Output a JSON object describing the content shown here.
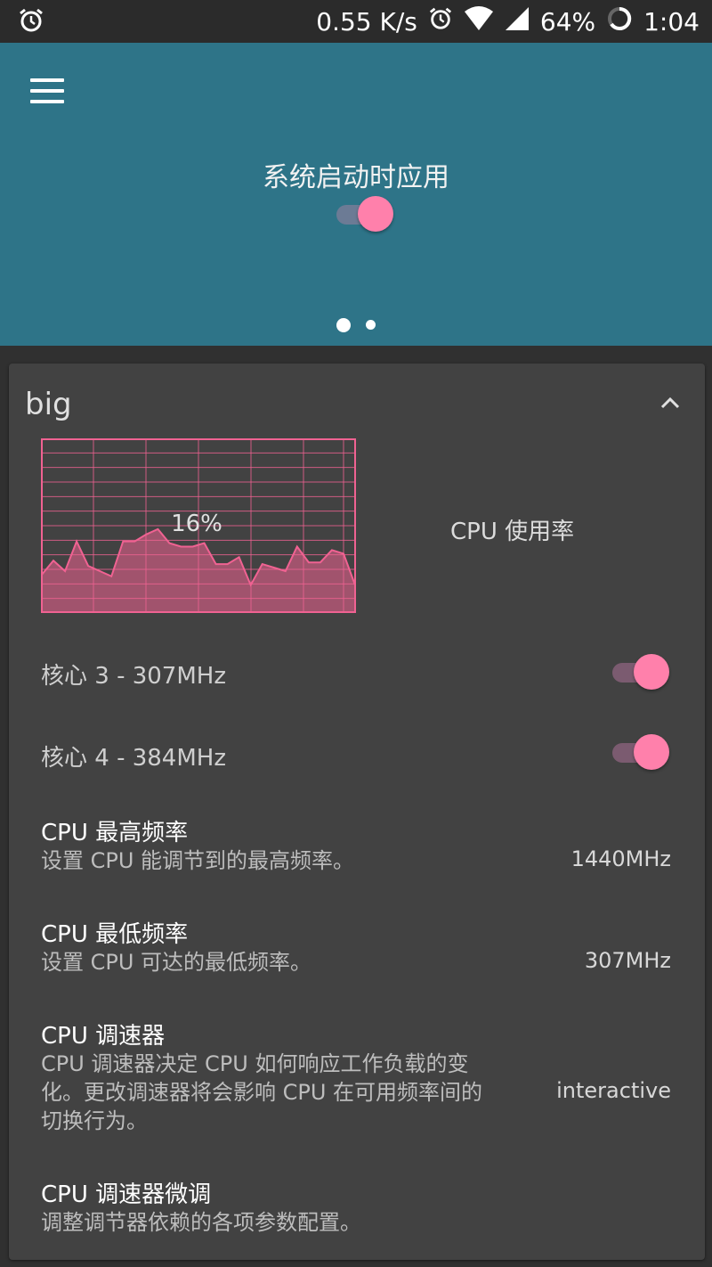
{
  "status_bar": {
    "network_speed": "0.55 K/s",
    "battery": "64%",
    "time": "1:04",
    "icons": [
      "alarm-icon",
      "alarm-icon",
      "wifi-icon",
      "signal-icon",
      "battery-icon"
    ]
  },
  "header": {
    "menu_icon": "hamburger-menu-icon",
    "title": "系统启动时应用",
    "apply_on_boot": true,
    "page_indicator": {
      "count": 2,
      "active": 0
    }
  },
  "card": {
    "title": "big",
    "collapse_icon": "chevron-up-icon",
    "cpu_usage": {
      "label": "CPU 使用率",
      "percent_text": "16%",
      "history": [
        22,
        30,
        24,
        41,
        27,
        24,
        21,
        41,
        41,
        45,
        48,
        40,
        38,
        38,
        40,
        28,
        28,
        32,
        16,
        28,
        26,
        24,
        38,
        29,
        29,
        36,
        34,
        16
      ]
    },
    "cores": [
      {
        "label": "核心 3 - 307MHz",
        "enabled": true
      },
      {
        "label": "核心 4 - 384MHz",
        "enabled": true
      }
    ],
    "items": [
      {
        "title": "CPU 最高频率",
        "desc": "设置 CPU 能调节到的最高频率。",
        "value": "1440MHz"
      },
      {
        "title": "CPU 最低频率",
        "desc": "设置 CPU 可达的最低频率。",
        "value": "307MHz"
      },
      {
        "title": "CPU 调速器",
        "desc_lines": [
          "CPU 调速器决定 CPU 如何响应工作负载的变",
          "化。更改调速器将会影响 CPU 在可用频率间的",
          "切换行为。"
        ],
        "value": "interactive"
      },
      {
        "title": "CPU 调速器微调",
        "desc": "调整调节器依赖的各项参数配置。"
      }
    ]
  },
  "colors": {
    "header_bg": "#2e7488",
    "card_bg": "#424242",
    "accent_pink": "#ff80ab",
    "graph_line": "#f06292"
  }
}
